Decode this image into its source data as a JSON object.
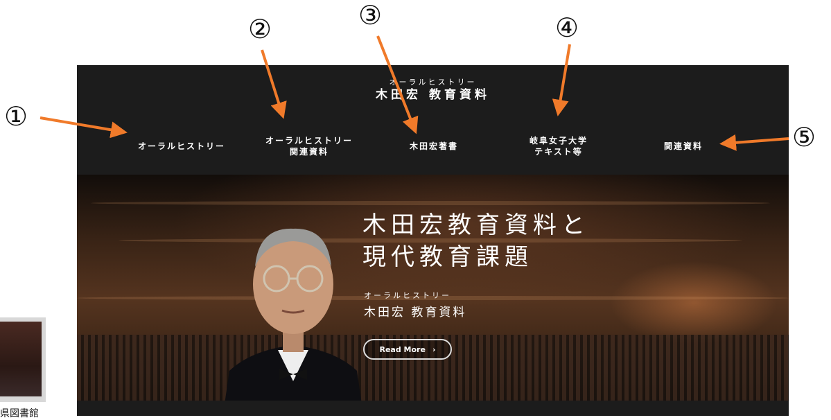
{
  "site": {
    "brand_sub": "オーラルヒストリー",
    "brand_main": "木田宏 教育資料",
    "nav": [
      {
        "line1": "オーラルヒストリー",
        "line2": ""
      },
      {
        "line1": "オーラルヒストリー",
        "line2": "関連資料"
      },
      {
        "line1": "木田宏著書",
        "line2": ""
      },
      {
        "line1": "岐阜女子大学",
        "line2": "テキスト等"
      },
      {
        "line1": "関連資料",
        "line2": ""
      }
    ]
  },
  "hero": {
    "title_line1": "木田宏教育資料と",
    "title_line2": "現代教育課題",
    "sub1": "オーラルヒストリー",
    "sub2": "木田宏 教育資料",
    "read_more": "Read More",
    "read_more_icon": "chevron-right-icon"
  },
  "annotations": {
    "labels": [
      "①",
      "②",
      "③",
      "④",
      "⑤"
    ],
    "arrow_color": "#f07a2a"
  },
  "side": {
    "caption": "県図書館"
  },
  "colors": {
    "header_bg": "#1c1c1c",
    "text": "#ffffff"
  }
}
